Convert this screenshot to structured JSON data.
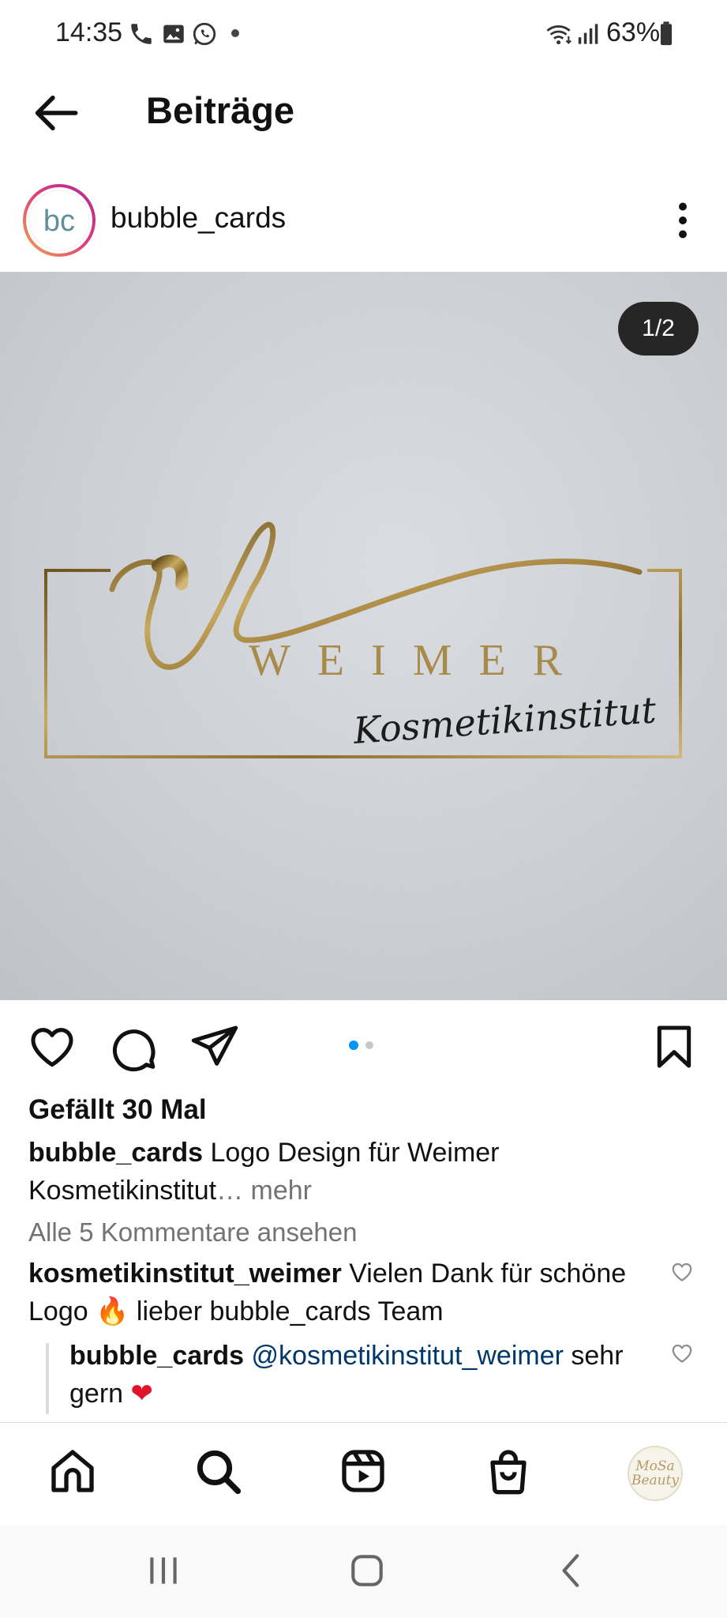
{
  "status_bar": {
    "time": "14:35",
    "battery": "63%",
    "icons": [
      "phone-icon",
      "gallery-icon",
      "whatsapp-icon",
      "notification-dot-icon",
      "wifi-icon",
      "signal-icon",
      "battery-icon"
    ]
  },
  "header": {
    "title": "Beiträge",
    "back_icon": "arrow-left-icon"
  },
  "post": {
    "username": "bubble_cards",
    "avatar_initials": "bc",
    "image_counter": "1/2",
    "image_brand_word": "WEIMER",
    "image_brand_sub": "Kosmetikinstitut",
    "carousel": {
      "current": 1,
      "total": 2
    },
    "likes": "Gefällt 30 Mal",
    "caption_user": "bubble_cards",
    "caption_text": " Logo Design für Weimer Kosmetikinstitut",
    "caption_more": "… mehr",
    "view_comments": "Alle 5 Kommentare ansehen",
    "comments": [
      {
        "user": "kosmetikinstitut_weimer",
        "text_a": " Vielen Dank für schöne Logo ",
        "emoji": "🔥",
        "text_b": "  lieber bubble_cards Team"
      },
      {
        "user": "bubble_cards",
        "mention": "@kosmetikinstitut_weimer",
        "text_a": " sehr gern ",
        "emoji": "❤"
      }
    ]
  },
  "bottom_nav": {
    "items": [
      "home-icon",
      "search-icon",
      "reels-icon",
      "shop-icon",
      "profile-avatar"
    ],
    "profile_text_1": "MoSa",
    "profile_text_2": "Beauty"
  },
  "colors": {
    "accent_blue": "#0095f6",
    "muted": "#737373",
    "mention": "#00376b",
    "gold": "#b08d3c"
  }
}
